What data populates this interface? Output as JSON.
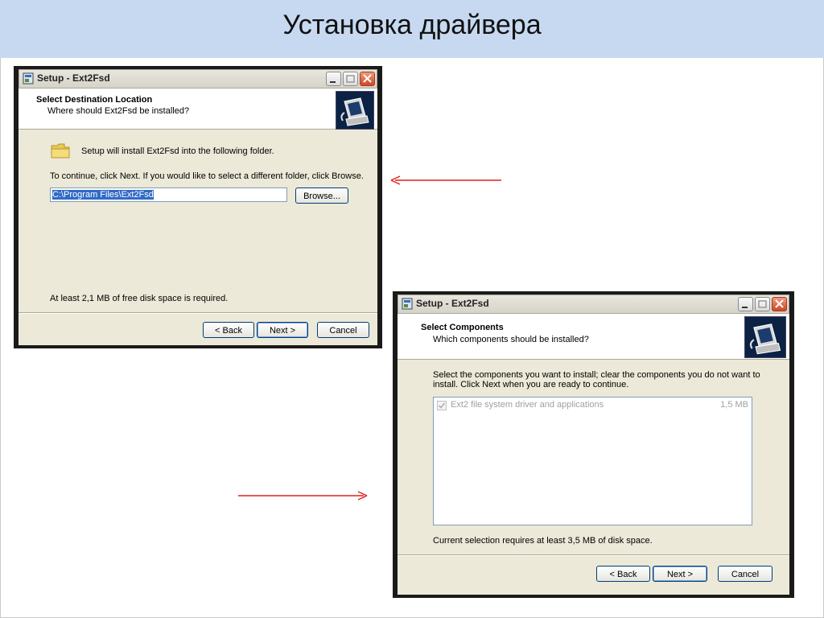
{
  "slide": {
    "title": "Установка драйвера"
  },
  "dialog1": {
    "window_title": "Setup - Ext2Fsd",
    "header_title": "Select Destination Location",
    "header_subtitle": "Where should Ext2Fsd be installed?",
    "info_text": "Setup will install Ext2Fsd into the following folder.",
    "instruction_text": "To continue, click Next. If you would like to select a different folder, click Browse.",
    "path_value": "C:\\Program Files\\Ext2Fsd",
    "browse_label": "Browse...",
    "disk_space_text": "At least 2,1 MB of free disk space is required.",
    "back_label": "< Back",
    "next_label": "Next >",
    "cancel_label": "Cancel"
  },
  "dialog2": {
    "window_title": "Setup - Ext2Fsd",
    "header_title": "Select Components",
    "header_subtitle": "Which components should be installed?",
    "instruction_line1": "Select the components you want to install; clear the components you do not want to",
    "instruction_line2": "install. Click Next when you are ready to continue.",
    "component_label": "Ext2 file system driver and applications",
    "component_size": "1,5 MB",
    "component_checked": true,
    "disk_space_text": "Current selection requires at least 3,5 MB of disk space.",
    "back_label": "< Back",
    "next_label": "Next >",
    "cancel_label": "Cancel"
  },
  "colors": {
    "title_band": "#c6d9f1",
    "arrow": "#e02020",
    "dialog_bg": "#ece9d8"
  }
}
